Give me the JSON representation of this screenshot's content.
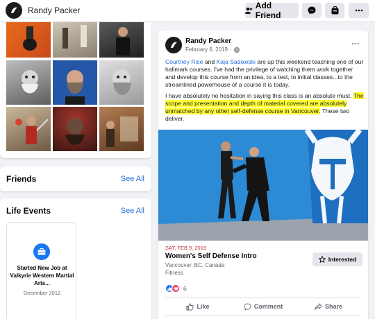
{
  "header": {
    "profile_name": "Randy Packer",
    "add_friend_label": "Add Friend"
  },
  "sidebar": {
    "friends_title": "Friends",
    "friends_see_all": "See All",
    "life_events_title": "Life Events",
    "life_events_see_all": "See All",
    "life_event": {
      "text": "Started New Job at Valkyrie Western Martial Arts...",
      "date": "December 2012"
    }
  },
  "post": {
    "author": "Randy Packer",
    "date": "February 6, 2019",
    "mention_1": "Courtney Rice",
    "and_word": "and",
    "mention_2": "Kaja Sadowski",
    "para1_rest": "are up this weekend teaching one of our hallmark courses. I've had the privilege of watching them work together and develop this course from an idea, to a test, to initial classes...to the streamlined powerhouse of a course it is today.",
    "para2_start": "I have absolutely no hesitation in saying this class is an absolute must.",
    "para2_highlight": "The scope and presentation and depth of material covered are absolutely unmatched by any other self-defense course in Vancouver.",
    "para2_end": "These two deliver.",
    "event": {
      "date": "SAT, FEB 9, 2019",
      "title": "Women's Self Defense Intro",
      "location": "Vancouver, BC, Canada",
      "category": "Fitness",
      "interested_label": "Interested"
    },
    "reaction_count": "6",
    "actions": {
      "like": "Like",
      "comment": "Comment",
      "share": "Share"
    }
  },
  "colors": {
    "accent": "#216fdb",
    "event_date": "#c4333b",
    "highlight": "#ffff33"
  }
}
